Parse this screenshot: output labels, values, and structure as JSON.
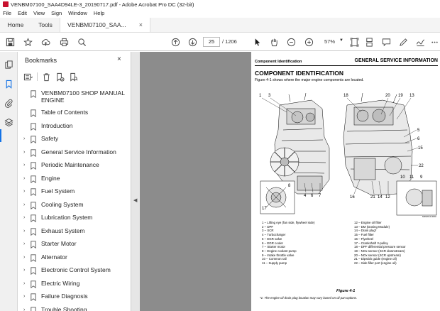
{
  "window": {
    "title": "VENBM07100_SAA4D94LE-3_20190717.pdf - Adobe Acrobat Pro DC (32-bit)"
  },
  "menu": [
    "File",
    "Edit",
    "View",
    "Sign",
    "Window",
    "Help"
  ],
  "tabs": {
    "home": "Home",
    "tools": "Tools",
    "document": "VENBM07100_SAA...",
    "close": "×"
  },
  "toolbar": {
    "page_current": "25",
    "page_total": "/ 1206",
    "zoom": "57%",
    "icons": [
      "save-icon",
      "bookmark-star-icon",
      "upload-cloud-icon",
      "print-icon",
      "search-zoom-icon",
      "prev-page-icon",
      "next-page-icon",
      "select-cursor-icon",
      "hand-icon",
      "zoom-out-icon",
      "zoom-in-icon",
      "fit-page-icon",
      "scrolling-mode-icon",
      "comment-icon",
      "pen-icon",
      "highlight-icon",
      "sign-icon",
      "share-icon"
    ]
  },
  "bookmarks": {
    "header": "Bookmarks",
    "close": "×",
    "items": [
      {
        "label": "VENBM07100 SHOP MANUAL ENGINE",
        "expandable": false,
        "two_line": true
      },
      {
        "label": "Table of Contents",
        "expandable": false
      },
      {
        "label": "Introduction",
        "expandable": false
      },
      {
        "label": "Safety",
        "expandable": true
      },
      {
        "label": "General Service Information",
        "expandable": true
      },
      {
        "label": "Periodic Maintenance",
        "expandable": true
      },
      {
        "label": "Engine",
        "expandable": true
      },
      {
        "label": "Fuel System",
        "expandable": true
      },
      {
        "label": "Cooling System",
        "expandable": true
      },
      {
        "label": "Lubrication System",
        "expandable": true
      },
      {
        "label": "Exhaust System",
        "expandable": true
      },
      {
        "label": "Starter Motor",
        "expandable": true
      },
      {
        "label": "Alternator",
        "expandable": true
      },
      {
        "label": "Electronic Control System",
        "expandable": true
      },
      {
        "label": "Electric Wiring",
        "expandable": true
      },
      {
        "label": "Failure Diagnosis",
        "expandable": true
      },
      {
        "label": "Trouble Shooting",
        "expandable": true
      }
    ]
  },
  "pdf_page": {
    "header_left": "Component Identification",
    "header_right": "GENERAL SERVICE INFORMATION",
    "section_title": "COMPONENT IDENTIFICATION",
    "intro": "Figure 4-1 shows where the major engine components are located.",
    "callouts_left_top": [
      "1",
      "3"
    ],
    "callouts_right_top": [
      "18",
      "20",
      "19",
      "13"
    ],
    "callouts_right_side": [
      "5",
      "6",
      "15"
    ],
    "callouts_mid": [
      "22"
    ],
    "callouts_bottom_left": [
      "4",
      "6",
      "7"
    ],
    "callouts_bottom_right": [
      "16",
      "21",
      "14",
      "12"
    ],
    "callouts_right_lower": [
      "10",
      "11",
      "9"
    ],
    "callouts_inset_left": [
      "17",
      "8"
    ],
    "image_code": "M09W14-0000",
    "captions_left": [
      "1 – Lifting eye (fan side, flywheel side)",
      "2 – DPF",
      "3 – SCR",
      "4 – Turbocharger",
      "5 – EGR valve",
      "6 – EGR cooler",
      "7 – Starter motor",
      "8 – Engine coolant pump",
      "9 – Intake throttle valve",
      "10 – Common rail",
      "11 – Supply pump"
    ],
    "captions_right": [
      "12 – Engine oil filter",
      "13 – DM (Dosing Module)",
      "14 – Drain plug*",
      "15 – Fuel filter",
      "16 – Flywheel",
      "17 – Crankshaft V-pulley",
      "18 – DPF differential pressure sensor",
      "19 – NOx sensor (SCR downstream)",
      "20 – NOx sensor (SCR upstream)",
      "21 – Dipstick guide (engine oil)",
      "22 – Side filler port (engine oil)"
    ],
    "figure_label": "Figure 4-1",
    "footnote": "*1: The engine oil drain plug location may vary based on oil pan options."
  }
}
